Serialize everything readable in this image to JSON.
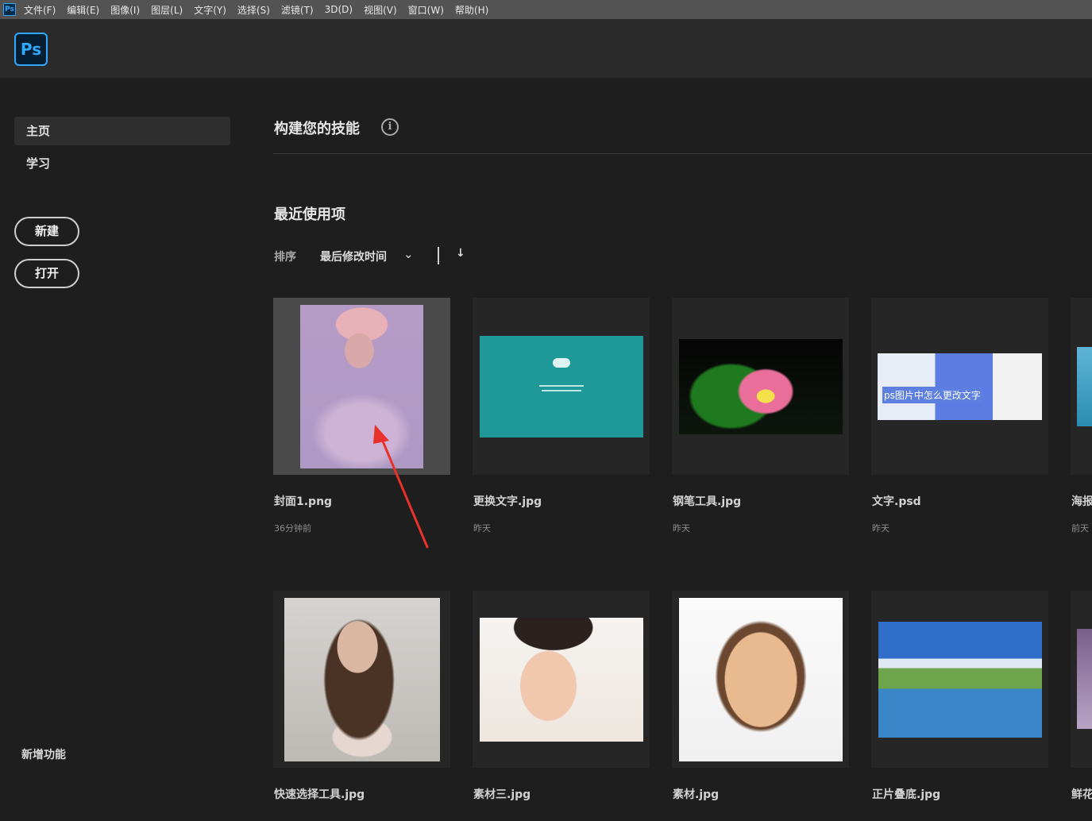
{
  "menubar": {
    "app_icon": "Ps",
    "items": [
      "文件(F)",
      "编辑(E)",
      "图像(I)",
      "图层(L)",
      "文字(Y)",
      "选择(S)",
      "滤镜(T)",
      "3D(D)",
      "视图(V)",
      "窗口(W)",
      "帮助(H)"
    ]
  },
  "header": {
    "logo": "Ps"
  },
  "sidebar": {
    "nav": [
      {
        "label": "主页",
        "active": true
      },
      {
        "label": "学习",
        "active": false
      }
    ],
    "new_button": "新建",
    "open_button": "打开",
    "whats_new": "新增功能"
  },
  "main": {
    "skills_title": "构建您的技能",
    "info_icon": "i",
    "recent_title": "最近使用项",
    "sort": {
      "label": "排序",
      "value": "最后修改时间",
      "chevron": "⌄",
      "direction_icon": "↓"
    },
    "recent_row1": [
      {
        "name": "封面1.png",
        "time": "36分钟前",
        "selected": true
      },
      {
        "name": "更换文字.jpg",
        "time": "昨天"
      },
      {
        "name": "钢笔工具.jpg",
        "time": "昨天"
      },
      {
        "name": "文字.psd",
        "time": "昨天",
        "thumb_text": "ps图片中怎么更改文字"
      },
      {
        "name": "海报",
        "time": "前天"
      }
    ],
    "recent_row2": [
      {
        "name": "快速选择工具.jpg"
      },
      {
        "name": "素材三.jpg"
      },
      {
        "name": "素材.jpg"
      },
      {
        "name": "正片叠底.jpg"
      },
      {
        "name": "鲜花"
      }
    ]
  },
  "colors": {
    "accent": "#31a8ff",
    "background": "#1e1e1e",
    "annotation_arrow": "#e8312a"
  }
}
